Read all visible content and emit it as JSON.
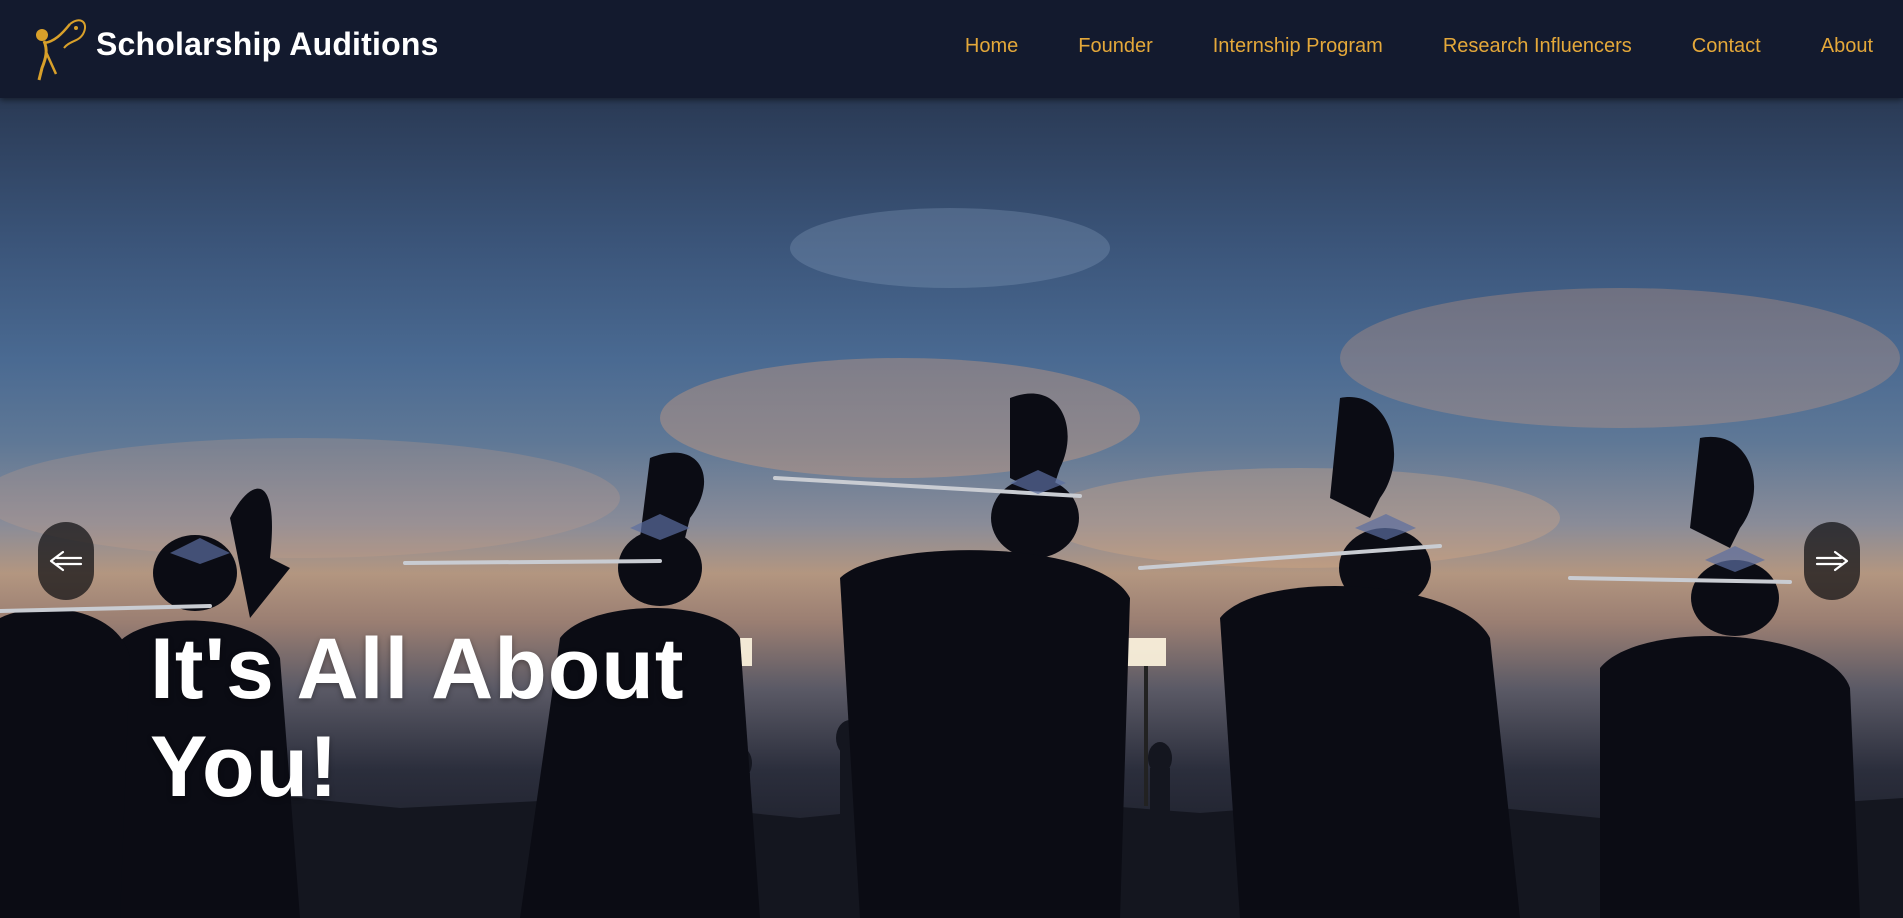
{
  "site": {
    "title": "Scholarship Auditions"
  },
  "nav": {
    "items": [
      {
        "label": "Home"
      },
      {
        "label": "Founder"
      },
      {
        "label": "Internship Program"
      },
      {
        "label": "Research Influencers"
      },
      {
        "label": "Contact"
      },
      {
        "label": "About"
      }
    ]
  },
  "hero": {
    "heading_line1": "It's All About",
    "heading_line2": "You!",
    "prev_icon": "arrow-left-icon",
    "next_icon": "arrow-right-icon"
  },
  "colors": {
    "header_bg": "#131a2e",
    "nav_link": "#e4a83a",
    "logo_gold": "#d8a02a",
    "heading": "#ffffff"
  }
}
